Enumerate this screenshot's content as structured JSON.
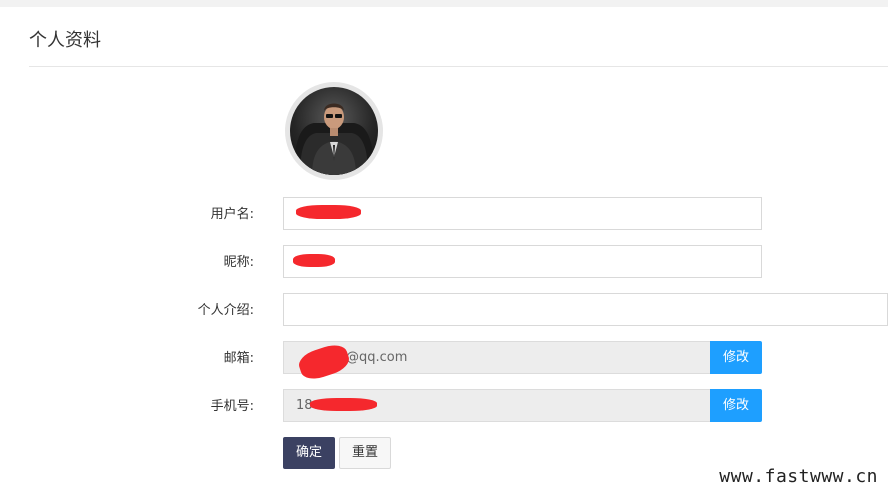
{
  "page": {
    "title": "个人资料"
  },
  "avatar": {
    "icon": "user-avatar-photo"
  },
  "form": {
    "username": {
      "label": "用户名:",
      "value": ""
    },
    "nickname": {
      "label": "昵称:",
      "value": ""
    },
    "bio": {
      "label": "个人介绍:",
      "value": ""
    },
    "email": {
      "label": "邮箱:",
      "value": "@qq.com",
      "button_label": "修改"
    },
    "phone": {
      "label": "手机号:",
      "value": "18",
      "button_label": "修改"
    }
  },
  "actions": {
    "confirm_label": "确定",
    "reset_label": "重置"
  },
  "watermark": {
    "text": "www.fastwww.cn"
  },
  "colors": {
    "accent_blue": "#1e9fff",
    "confirm_dark": "#3b4162",
    "redaction_red": "#f5282d"
  }
}
